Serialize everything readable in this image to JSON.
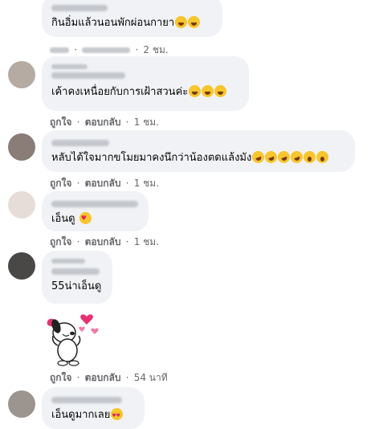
{
  "comments": [
    {
      "text": "กินอิ่มแล้วนอนพักผ่อนกายา",
      "emojis": [
        "laugh",
        "laugh"
      ],
      "actions": {
        "time": "2 ชม."
      }
    },
    {
      "text": "เค้าคงเหนื่อยกับการเฝ้าสวนค่ะ",
      "emojis": [
        "laugh",
        "laugh",
        "laugh"
      ],
      "actions": {
        "like": "ถูกใจ",
        "reply": "ตอบกลับ",
        "time": "1 ชม."
      }
    },
    {
      "text": "หลับได้ใจมากขโมยมาคงนึกว่าน้องตดแล้งมัง",
      "emojis": [
        "tears",
        "tears",
        "tears",
        "tears",
        "shock",
        "shock"
      ],
      "actions": {
        "like": "ถูกใจ",
        "reply": "ตอบกลับ",
        "time": "1 ชม."
      }
    },
    {
      "text": "เอ็นดู",
      "emojis": [
        "hearts"
      ],
      "actions": {
        "like": "ถูกใจ",
        "reply": "ตอบกลับ",
        "time": "1 ชม."
      }
    },
    {
      "text": "55น่าเอ็นดู",
      "emojis": [],
      "sticker": "snoopy-hearts-sticker",
      "actions": {
        "like": "ถูกใจ",
        "reply": "ตอบกลับ",
        "time": "54 นาที"
      }
    },
    {
      "text": "เอ็นดูมากเลย",
      "emojis": [
        "hearteyes"
      ]
    }
  ],
  "separator": "·"
}
